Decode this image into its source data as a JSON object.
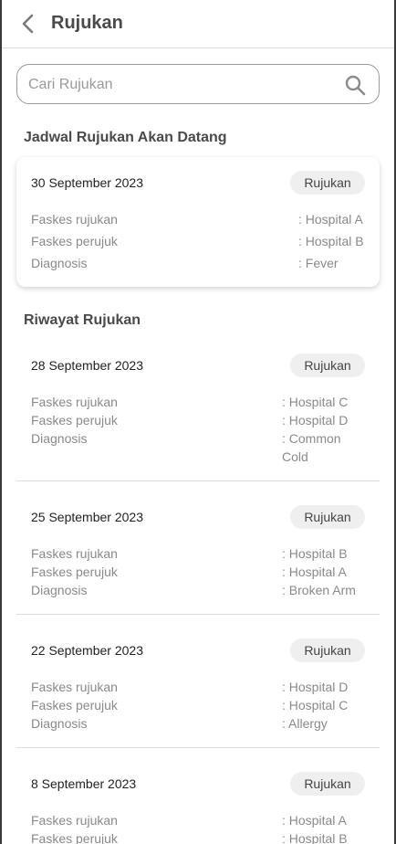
{
  "header": {
    "title": "Rujukan"
  },
  "search": {
    "placeholder": "Cari Rujukan"
  },
  "upcoming": {
    "section_title": "Jadwal Rujukan Akan Datang",
    "card": {
      "date": "30 September 2023",
      "badge": "Rujukan",
      "fields": [
        {
          "label": "Faskes rujukan",
          "value": ": Hospital A"
        },
        {
          "label": "Faskes perujuk",
          "value": ": Hospital B"
        },
        {
          "label": "Diagnosis",
          "value": ": Fever"
        }
      ]
    }
  },
  "history": {
    "section_title": "Riwayat Rujukan",
    "items": [
      {
        "date": "28 September 2023",
        "badge": "Rujukan",
        "fields": [
          {
            "label": "Faskes rujukan",
            "value": ": Hospital C"
          },
          {
            "label": "Faskes perujuk",
            "value": ": Hospital D"
          },
          {
            "label": "Diagnosis",
            "value": ": Common",
            "value_cont": "Cold"
          }
        ]
      },
      {
        "date": "25 September 2023",
        "badge": "Rujukan",
        "fields": [
          {
            "label": "Faskes rujukan",
            "value": ": Hospital B"
          },
          {
            "label": "Faskes perujuk",
            "value": ": Hospital A"
          },
          {
            "label": "Diagnosis",
            "value": ": Broken Arm"
          }
        ]
      },
      {
        "date": "22 September 2023",
        "badge": "Rujukan",
        "fields": [
          {
            "label": "Faskes rujukan",
            "value": ": Hospital D"
          },
          {
            "label": "Faskes perujuk",
            "value": ": Hospital C"
          },
          {
            "label": "Diagnosis",
            "value": ": Allergy"
          }
        ]
      },
      {
        "date": "8 September 2023",
        "badge": "Rujukan",
        "fields": [
          {
            "label": "Faskes rujukan",
            "value": ": Hospital A"
          },
          {
            "label": "Faskes perujuk",
            "value": ": Hospital B"
          }
        ]
      }
    ]
  }
}
